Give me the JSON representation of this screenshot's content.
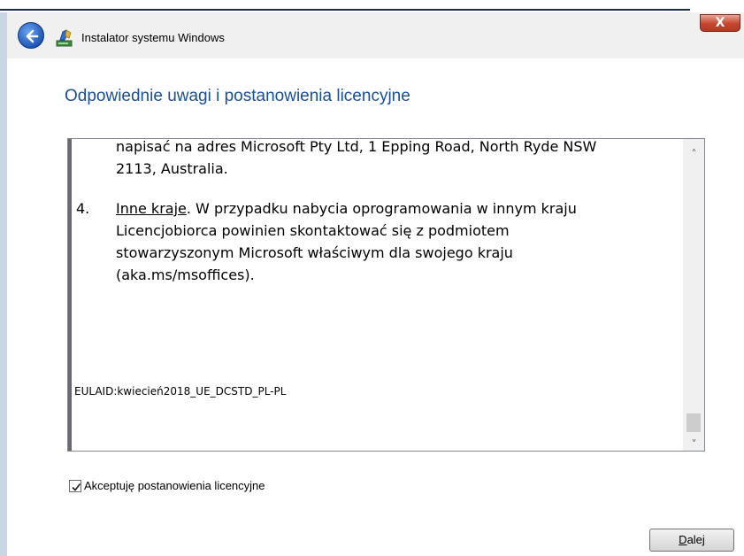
{
  "window": {
    "title": "Instalator systemu Windows",
    "close_glyph": "X",
    "back_icon": "back-arrow-icon",
    "app_icon": "windows-setup-icon"
  },
  "page": {
    "title": "Odpowiednie uwagi i postanowienia licencyjne"
  },
  "license": {
    "line1": "napisać na adres Microsoft Pty Ltd, 1 Epping Road, North Ryde NSW",
    "line2": "2113, Australia.",
    "item_number": "4.",
    "item_heading": "Inne kraje",
    "item_line1_rest": ". W przypadku nabycia oprogramowania w innym kraju",
    "item_line2": "Licencjobiorca powinien skontaktować się z podmiotem",
    "item_line3": "stowarzyszonym Microsoft właściwym dla swojego kraju",
    "item_line4": "(aka.ms/msoffices).",
    "eula_id": "EULAID:kwiecień2018_UE_DCSTD_PL-PL",
    "scroll_up_glyph": "˄",
    "scroll_down_glyph": "˅"
  },
  "accept": {
    "label": "Akceptuję postanowienia licencyjne",
    "checked": true
  },
  "buttons": {
    "next_access_key": "D",
    "next_rest": "alej"
  },
  "colors": {
    "title_blue": "#1a4f95",
    "close_red": "#c7452e",
    "back_blue": "#1e57b8"
  }
}
